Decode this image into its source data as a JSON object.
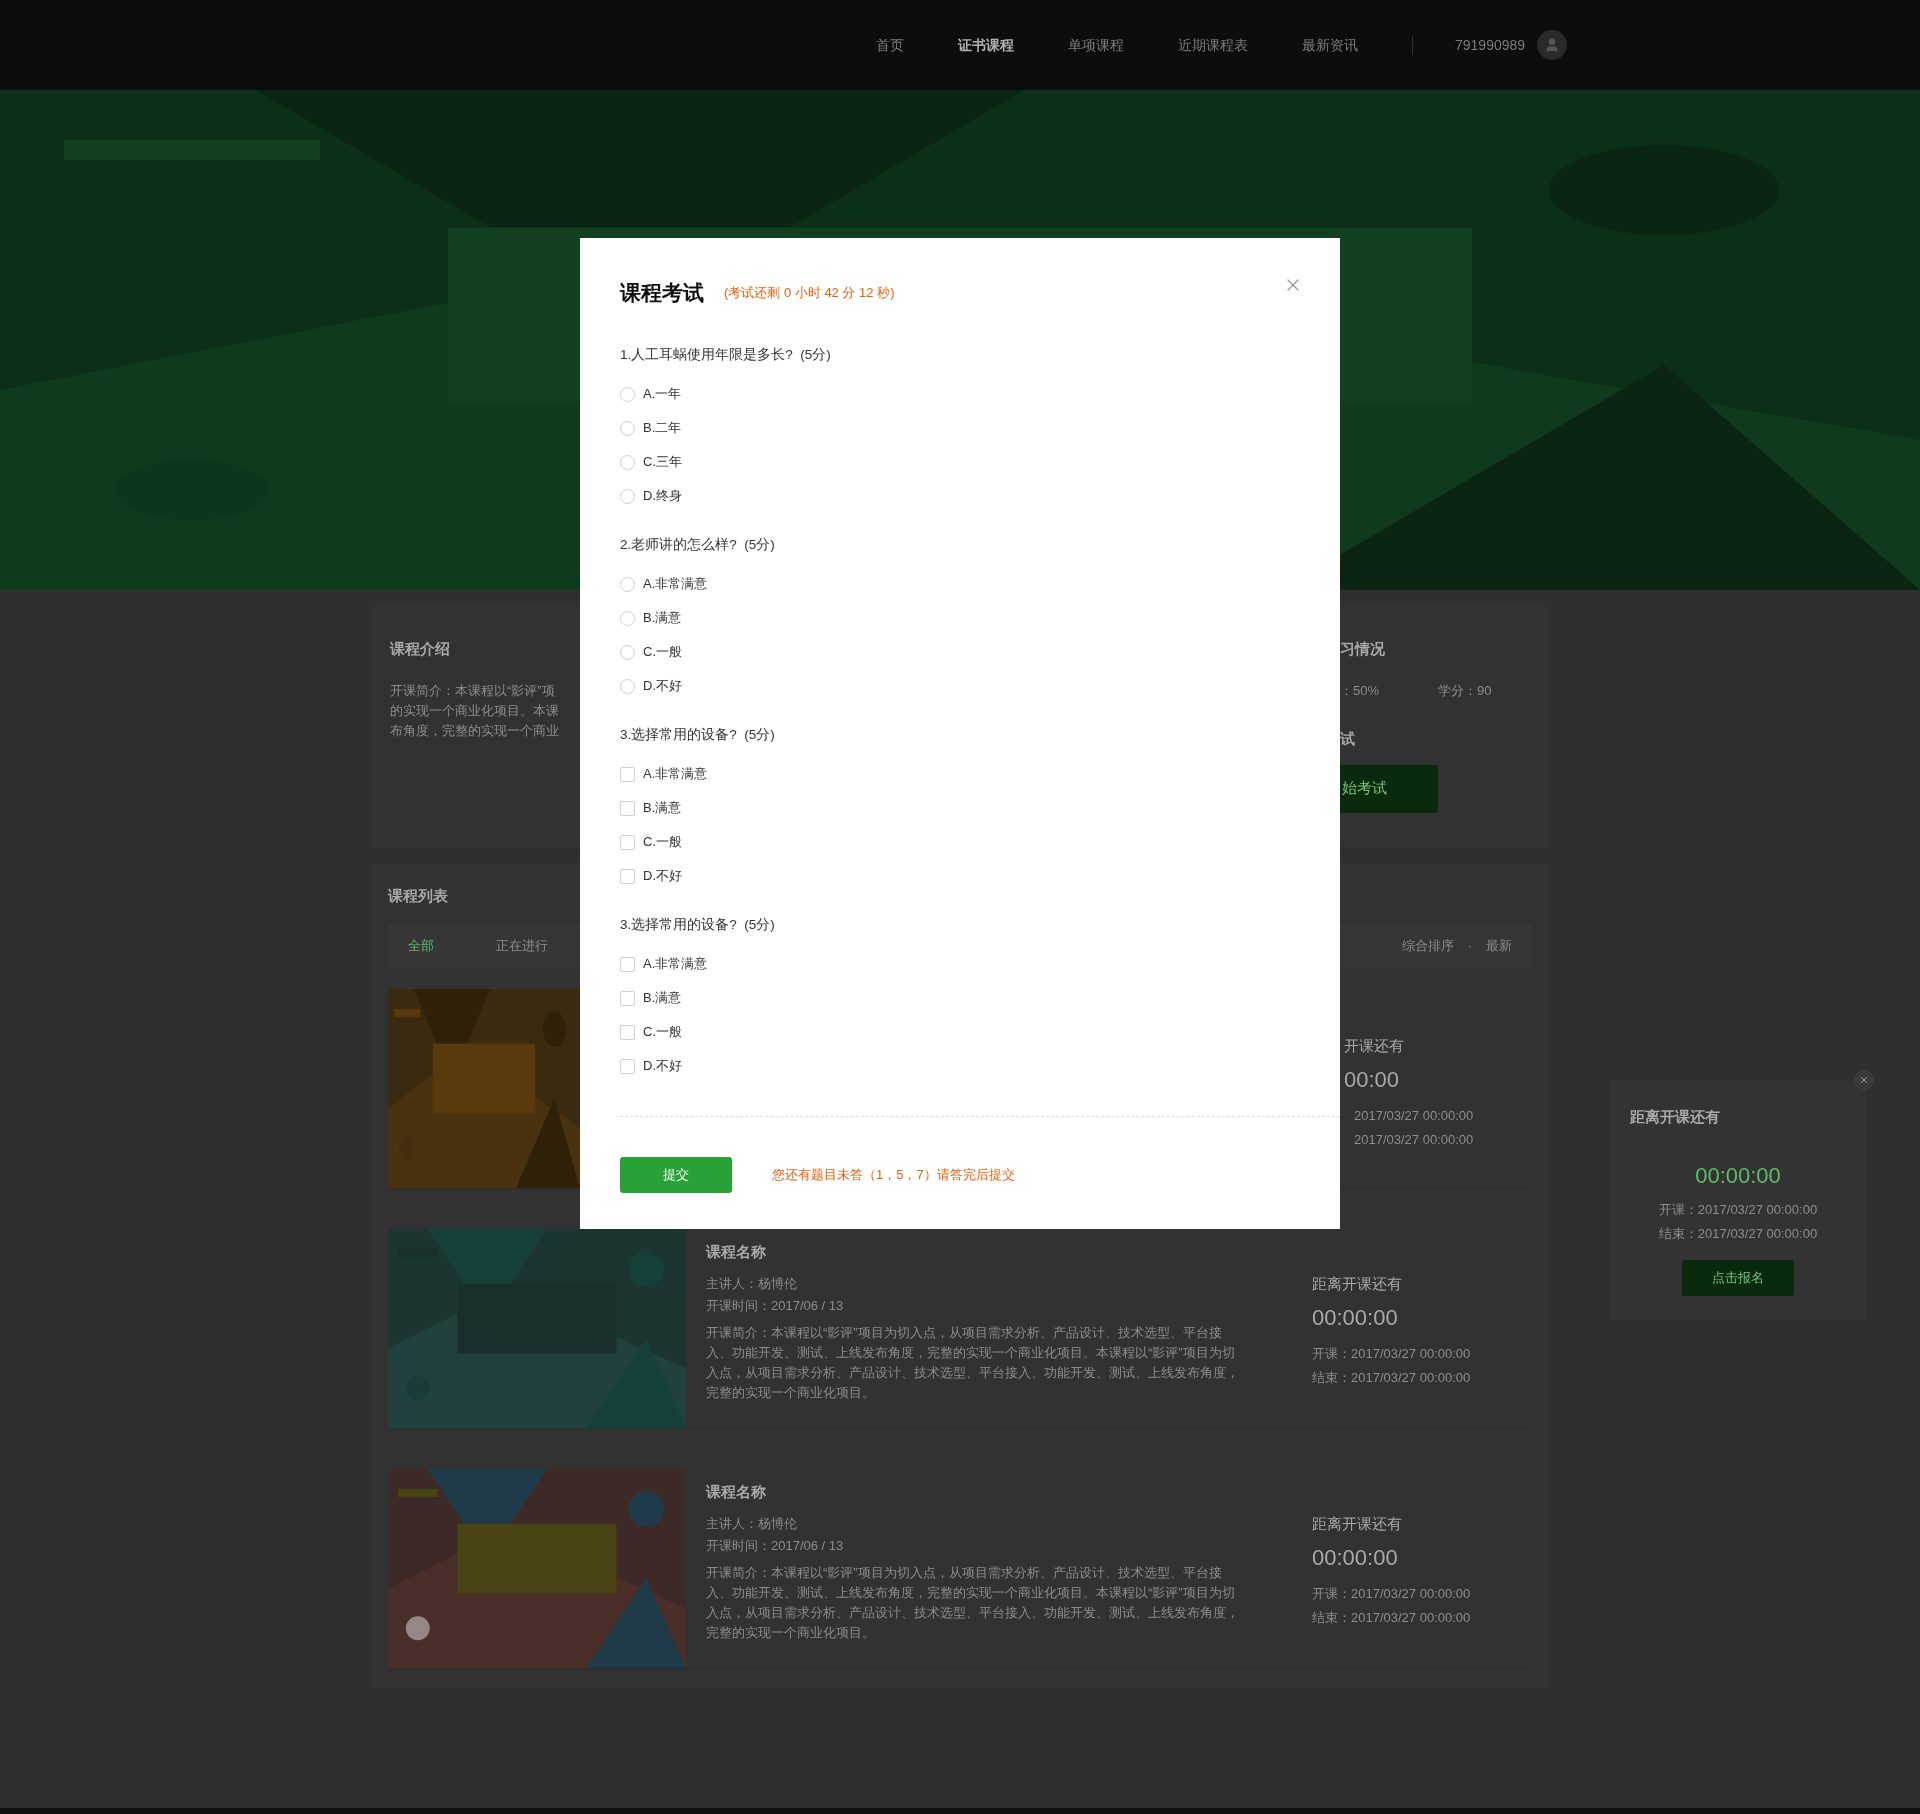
{
  "nav": {
    "items": [
      {
        "label": "首页",
        "selected": false
      },
      {
        "label": "证书课程",
        "selected": true
      },
      {
        "label": "单项课程",
        "selected": false
      },
      {
        "label": "近期课程表",
        "selected": false
      },
      {
        "label": "最新资讯",
        "selected": false
      }
    ],
    "username": "791990989"
  },
  "course_intro": {
    "title": "课程介绍",
    "lines": [
      "开课简介：本课程以“影评”项",
      "的实现一个商业化项目。本课",
      "布角度，完整的实现一个商业"
    ]
  },
  "study_status": {
    "title": "习情况",
    "progress": "：50%",
    "credits": "学分：90",
    "exam_title": "试",
    "exam_button": "始考试"
  },
  "course_list": {
    "title": "课程列表",
    "filters": [
      {
        "label": "全部",
        "selected": true
      },
      {
        "label": "正在进行",
        "selected": false
      }
    ],
    "sorts": [
      "综合排序",
      "最新"
    ],
    "sort_separator": "·",
    "courses": [
      {
        "kind": "partial",
        "countdown_label": "开课还有",
        "countdown": "00:00",
        "start": "2017/03/27 00:00:00",
        "end": "2017/03/27 00:00:00"
      },
      {
        "kind": "full",
        "name": "课程名称",
        "teacher": "主讲人：杨博伦",
        "time": "开课时间：2017/06 / 13",
        "intro": "开课简介：本课程以“影评”项目为切入点，从项目需求分析、产品设计、技术选型、平台接入、功能开发、测试、上线发布角度，完整的实现一个商业化项目。本课程以“影评”项目为切入点，从项目需求分析、产品设计、技术选型、平台接入、功能开发、测试、上线发布角度，完整的实现一个商业化项目。",
        "countdown_label": "距离开课还有",
        "countdown": "00:00:00",
        "start": "开课：2017/03/27 00:00:00",
        "end": "结束：2017/03/27 00:00:00"
      },
      {
        "kind": "full",
        "name": "课程名称",
        "teacher": "主讲人：杨博伦",
        "time": "开课时间：2017/06 / 13",
        "intro": "开课简介：本课程以“影评”项目为切入点，从项目需求分析、产品设计、技术选型、平台接入、功能开发、测试、上线发布角度，完整的实现一个商业化项目。本课程以“影评”项目为切入点，从项目需求分析、产品设计、技术选型、平台接入、功能开发、测试、上线发布角度，完整的实现一个商业化项目。",
        "countdown_label": "距离开课还有",
        "countdown": "00:00:00",
        "start": "开课：2017/03/27 00:00:00",
        "end": "结束：2017/03/27 00:00:00"
      }
    ]
  },
  "floating_panel": {
    "title": "距离开课还有",
    "countdown": "00:00:00",
    "start": "开课：2017/03/27 00:00:00",
    "end": "结束：2017/03/27 00:00:00",
    "button": "点击报名"
  },
  "exam_dialog": {
    "title": "课程考试",
    "timer": "(考试还剩 0 小时 42 分 12 秒)",
    "questions": [
      {
        "kind": "single",
        "text": "1.人工耳蜗使用年限是多长?  (5分)",
        "options": [
          {
            "label": "A.一年",
            "selected": false
          },
          {
            "label": "B.二年",
            "selected": false
          },
          {
            "label": "C.三年",
            "selected": false
          },
          {
            "label": "D.终身",
            "selected": false
          }
        ]
      },
      {
        "kind": "single",
        "text": "2.老师讲的怎么样?  (5分)",
        "options": [
          {
            "label": "A.非常满意",
            "selected": false
          },
          {
            "label": "B.满意",
            "selected": false
          },
          {
            "label": "C.一般",
            "selected": false
          },
          {
            "label": "D.不好",
            "selected": false
          }
        ]
      },
      {
        "kind": "multiple",
        "text": "3.选择常用的设备?  (5分)",
        "options": [
          {
            "label": "A.非常满意",
            "selected": false
          },
          {
            "label": "B.满意",
            "selected": false
          },
          {
            "label": "C.一般",
            "selected": false
          },
          {
            "label": "D.不好",
            "selected": false
          }
        ]
      },
      {
        "kind": "multiple",
        "text": "3.选择常用的设备?  (5分)",
        "options": [
          {
            "label": "A.非常满意",
            "selected": false
          },
          {
            "label": "B.满意",
            "selected": false
          },
          {
            "label": "C.一般",
            "selected": false
          },
          {
            "label": "D.不好",
            "selected": false
          }
        ]
      }
    ],
    "submit": "提交",
    "warning": "您还有题目未答（1，5，7）请答完后提交"
  }
}
